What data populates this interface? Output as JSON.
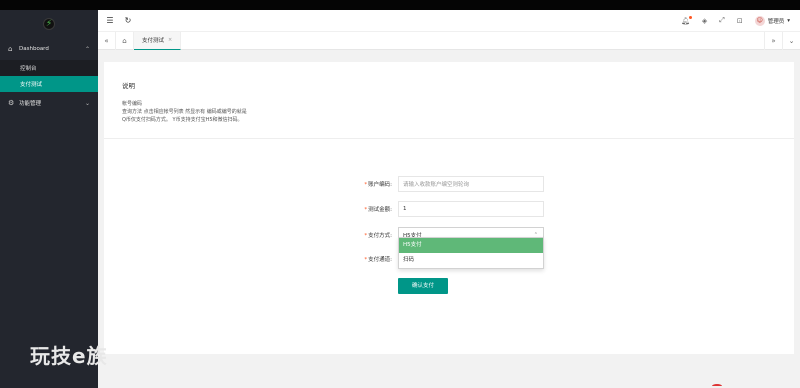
{
  "sidebar": {
    "logo_icon": "leaf-logo-icon",
    "sections": [
      {
        "label": "Dashboard",
        "icon": "home-icon",
        "arrow": "^",
        "items": [
          {
            "label": "控制台",
            "active": false
          },
          {
            "label": "支付测试",
            "active": true
          }
        ]
      },
      {
        "label": "功能管理",
        "icon": "gear-icon",
        "arrow": "v",
        "items": []
      }
    ]
  },
  "header": {
    "menu_icon": "☰",
    "refresh_icon": "↻",
    "user_name": "管理员",
    "user_caret": "▾"
  },
  "tabs": {
    "items": [
      {
        "label": "支付测试",
        "close": "×"
      }
    ]
  },
  "content": {
    "title": "说明",
    "desc_lines": [
      "帐号编码",
      "查询方法 点击相应帐号列表 然显示有 编码或编号的就是",
      "Q币仅支付扫码方式。  Y币支持支付宝H5和微信扫码。"
    ],
    "form": {
      "account": {
        "label": "账户编码:",
        "placeholder": "请输入收款账户编空则轮询"
      },
      "amount": {
        "label": "测试金额:",
        "value": "1"
      },
      "method": {
        "label": "支付方式:",
        "value": "H5支付"
      },
      "channel": {
        "label": "支付通道:"
      },
      "options": [
        "H5支付",
        "扫码"
      ],
      "submit": "确认支付"
    }
  },
  "watermark": "玩技e族",
  "colors": {
    "accent": "#009688",
    "sidebar_bg": "#23262e",
    "option_selected": "#5fb878",
    "required": "#ff5722"
  }
}
